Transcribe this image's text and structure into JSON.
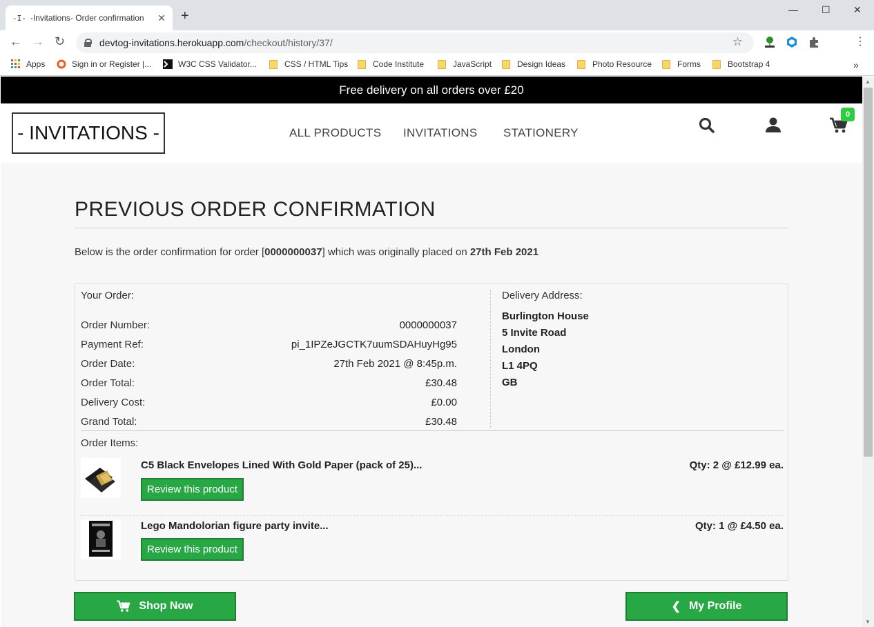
{
  "browser": {
    "tab_favicon": "-I-",
    "tab_title": "-Invitations- Order confirmation",
    "url_host": "devtog-invitations.herokuapp.com",
    "url_path": "/checkout/history/37/",
    "bookmarks": [
      {
        "label": "Apps",
        "icon": "apps-grid-icon"
      },
      {
        "label": "Sign in or Register |...",
        "icon": "circle-icon"
      },
      {
        "label": "W3C CSS Validator...",
        "icon": "w3c-icon"
      },
      {
        "label": "CSS / HTML Tips",
        "icon": "folder-icon"
      },
      {
        "label": "Code Institute",
        "icon": "folder-icon"
      },
      {
        "label": "JavaScript",
        "icon": "folder-icon"
      },
      {
        "label": "Design Ideas",
        "icon": "folder-icon"
      },
      {
        "label": "Photo Resource",
        "icon": "folder-icon"
      },
      {
        "label": "Forms",
        "icon": "folder-icon"
      },
      {
        "label": "Bootstrap 4",
        "icon": "folder-icon"
      }
    ],
    "bookmarks_overflow": "»"
  },
  "site": {
    "banner": "Free delivery on all orders over £20",
    "logo": "- INVITATIONS -",
    "nav": [
      "ALL PRODUCTS",
      "INVITATIONS",
      "STATIONERY"
    ],
    "cart_count": "0"
  },
  "order": {
    "heading": "PREVIOUS  ORDER CONFIRMATION",
    "intro_prefix": "Below is the order confirmation for order [",
    "intro_number": "0000000037",
    "intro_mid": "] which was originally placed on ",
    "intro_date": "27th Feb 2021",
    "your_order_label": "Your Order:",
    "fields": [
      {
        "label": "Order Number:",
        "value": "0000000037"
      },
      {
        "label": "Payment Ref:",
        "value": "pi_1IPZeJGCTK7uumSDAHuyHg95"
      },
      {
        "label": "Order Date:",
        "value": "27th Feb 2021 @ 8:45p.m."
      },
      {
        "label": "Order Total:",
        "value": "£30.48"
      },
      {
        "label": "Delivery Cost:",
        "value": "£0.00"
      },
      {
        "label": "Grand Total:",
        "value": "£30.48"
      }
    ],
    "delivery_label": "Delivery Address:",
    "address": [
      "Burlington House",
      "5 Invite Road",
      "London",
      "L1 4PQ",
      "GB"
    ],
    "items_label": "Order Items:",
    "items": [
      {
        "name": "C5 Black Envelopes Lined With Gold Paper (pack of 25)...",
        "qty": "Qty: 2 @ £12.99 ea.",
        "review": "Review this product"
      },
      {
        "name": "Lego Mandolorian figure party invite...",
        "qty": "Qty: 1 @ £4.50 ea.",
        "review": "Review this product"
      }
    ],
    "shop_now": "Shop Now",
    "my_profile": "My Profile"
  }
}
